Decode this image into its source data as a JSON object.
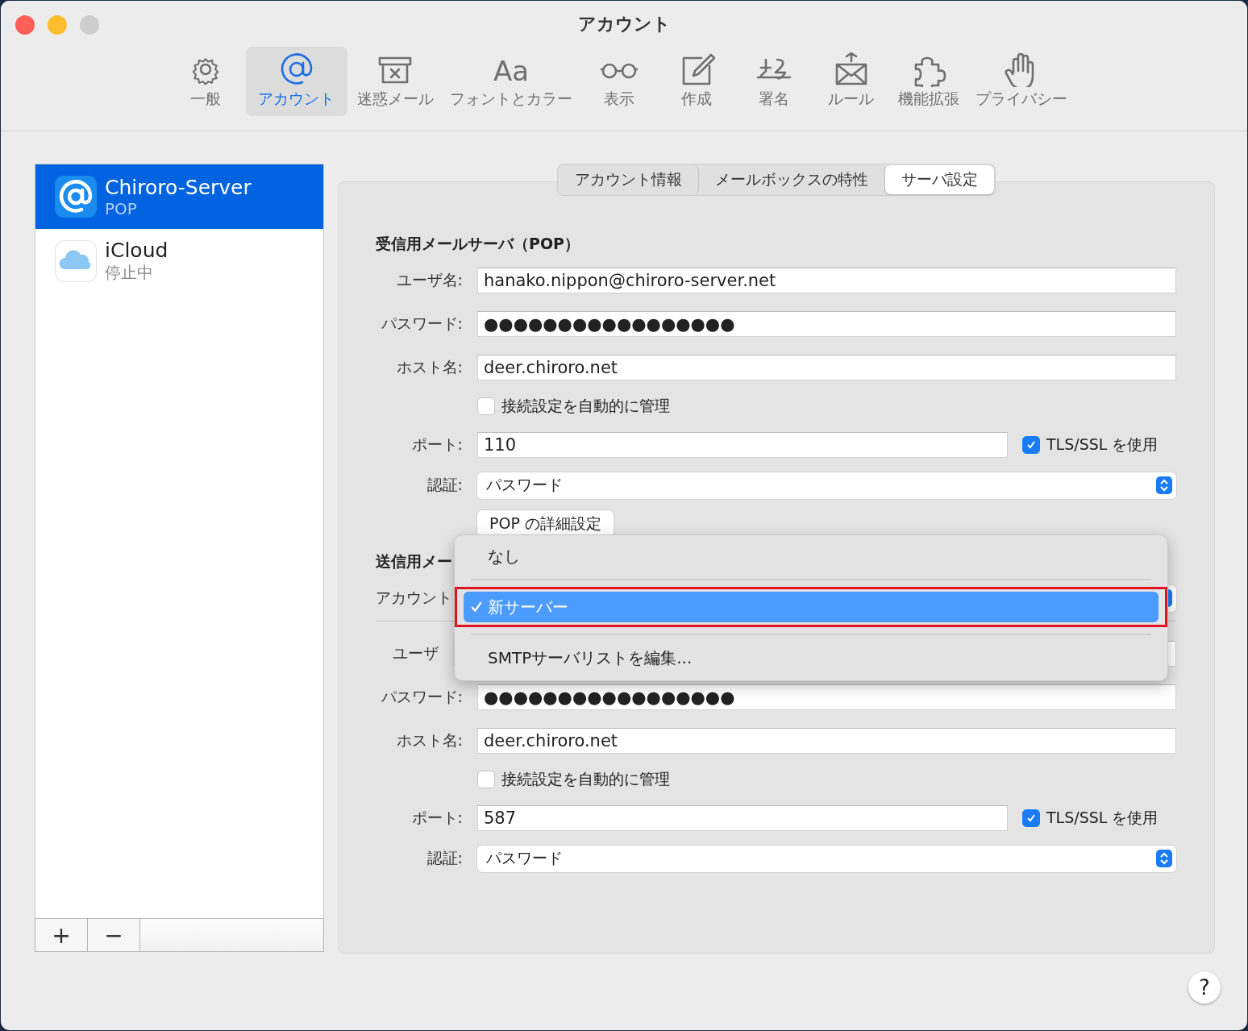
{
  "window": {
    "title": "アカウント"
  },
  "toolbar": [
    {
      "label": "一般",
      "selected": false
    },
    {
      "label": "アカウント",
      "selected": true
    },
    {
      "label": "迷惑メール",
      "selected": false
    },
    {
      "label": "フォントとカラー",
      "selected": false,
      "icon_text": "Aa"
    },
    {
      "label": "表示",
      "selected": false
    },
    {
      "label": "作成",
      "selected": false
    },
    {
      "label": "署名",
      "selected": false
    },
    {
      "label": "ルール",
      "selected": false
    },
    {
      "label": "機能拡張",
      "selected": false
    },
    {
      "label": "プライバシー",
      "selected": false
    }
  ],
  "accounts": [
    {
      "kind": "at",
      "name": "Chiroro-Server",
      "subtitle": "POP",
      "selected": true
    },
    {
      "kind": "cloud",
      "name": "iCloud",
      "subtitle": "停止中",
      "selected": false
    }
  ],
  "list_buttons": [
    "+",
    "−"
  ],
  "tabs": [
    {
      "label": "アカウント情報",
      "selected": false
    },
    {
      "label": "メールボックスの特性",
      "selected": false
    },
    {
      "label": "サーバ設定",
      "selected": true
    }
  ],
  "incoming": {
    "title": "受信用メールサーバ（POP）",
    "rows": [
      {
        "kind": "text",
        "label": "ユーザ名:",
        "value": "hanako.nippon@chiroro-server.net"
      },
      {
        "kind": "text",
        "label": "パスワード:",
        "value": "●●●●●●●●●●●●●●●●●"
      },
      {
        "kind": "text",
        "label": "ホスト名:",
        "value": "deer.chiroro.net"
      },
      {
        "kind": "checkbox",
        "label": "接続設定を自動的に管理",
        "checked": false
      },
      {
        "kind": "port",
        "label": "ポート:",
        "value": "110",
        "tls_label": "TLS/SSL を使用",
        "checked": true
      },
      {
        "kind": "select",
        "label": "認証:",
        "value": "パスワード"
      },
      {
        "kind": "button",
        "value": "POP の詳細設定"
      }
    ]
  },
  "outgoing": {
    "title": "送信用メー",
    "rows": [
      {
        "kind": "menu_select",
        "label": "アカウント"
      },
      {
        "kind": "divider"
      },
      {
        "kind": "covered_text",
        "label": "ユーザ"
      },
      {
        "kind": "text",
        "label": "パスワード:",
        "value": "●●●●●●●●●●●●●●●●●"
      },
      {
        "kind": "text",
        "label": "ホスト名:",
        "value": "deer.chiroro.net"
      },
      {
        "kind": "checkbox",
        "label": "接続設定を自動的に管理",
        "checked": false
      },
      {
        "kind": "port",
        "label": "ポート:",
        "value": "587",
        "tls_label": "TLS/SSL を使用",
        "checked": true
      },
      {
        "kind": "select",
        "label": "認証:",
        "value": "パスワード"
      }
    ]
  },
  "popup_menu": {
    "items": [
      {
        "label": "なし",
        "selected": false,
        "highlighted": false
      },
      {
        "label": "新サーバー",
        "selected": true,
        "highlighted": true
      },
      {
        "label": "SMTPサーバリストを編集...",
        "selected": false,
        "highlighted": false
      }
    ]
  },
  "help_button": "?"
}
